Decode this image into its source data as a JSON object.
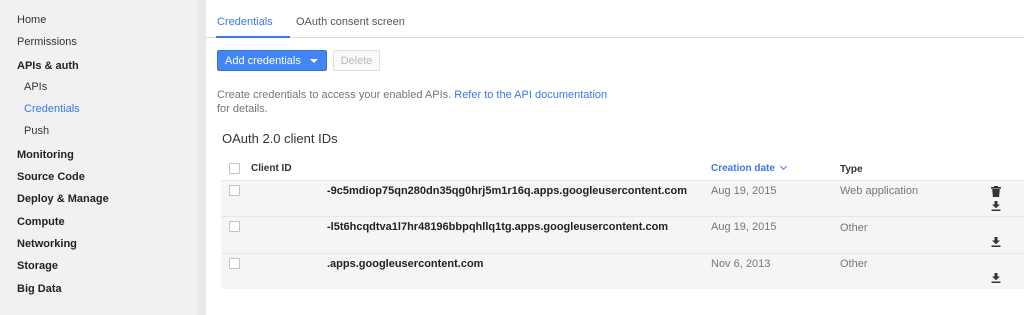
{
  "sidebar": {
    "items": [
      {
        "label": "Home"
      },
      {
        "label": "Permissions"
      },
      {
        "label": "APIs & auth"
      },
      {
        "label": "APIs"
      },
      {
        "label": "Credentials"
      },
      {
        "label": "Push"
      },
      {
        "label": "Monitoring"
      },
      {
        "label": "Source Code"
      },
      {
        "label": "Deploy & Manage"
      },
      {
        "label": "Compute"
      },
      {
        "label": "Networking"
      },
      {
        "label": "Storage"
      },
      {
        "label": "Big Data"
      }
    ]
  },
  "tabs": [
    {
      "label": "Credentials",
      "active": true
    },
    {
      "label": "OAuth consent screen",
      "active": false
    }
  ],
  "toolbar": {
    "add_label": "Add credentials",
    "delete_label": "Delete"
  },
  "description": {
    "text": "Create credentials to access your enabled APIs.",
    "link": "Refer to the API documentation",
    "tail": "for details."
  },
  "section_title": "OAuth 2.0 client IDs",
  "table": {
    "headers": {
      "client_id": "Client ID",
      "creation_date": "Creation date",
      "type": "Type"
    },
    "rows": [
      {
        "client_id": "-9c5mdiop75qn280dn35qg0hrj5m1r16q.apps.googleusercontent.com",
        "date": "Aug 19, 2015",
        "type": "Web application"
      },
      {
        "client_id": "-l5t6hcqdtva1l7hr48196bbpqhllq1tg.apps.googleusercontent.com",
        "date": "Aug 19, 2015",
        "type": "Other"
      },
      {
        "client_id": ".apps.googleusercontent.com",
        "date": "Nov 6, 2013",
        "type": "Other"
      }
    ]
  },
  "colors": {
    "accent": "#3b78e7",
    "button_primary": "#4285f4",
    "sidebar_bg": "#f1f1f1",
    "row_bg": "#f5f5f5"
  },
  "icons": {
    "delete": "trash-icon",
    "download": "download-icon",
    "sort": "chevron-down-icon"
  }
}
